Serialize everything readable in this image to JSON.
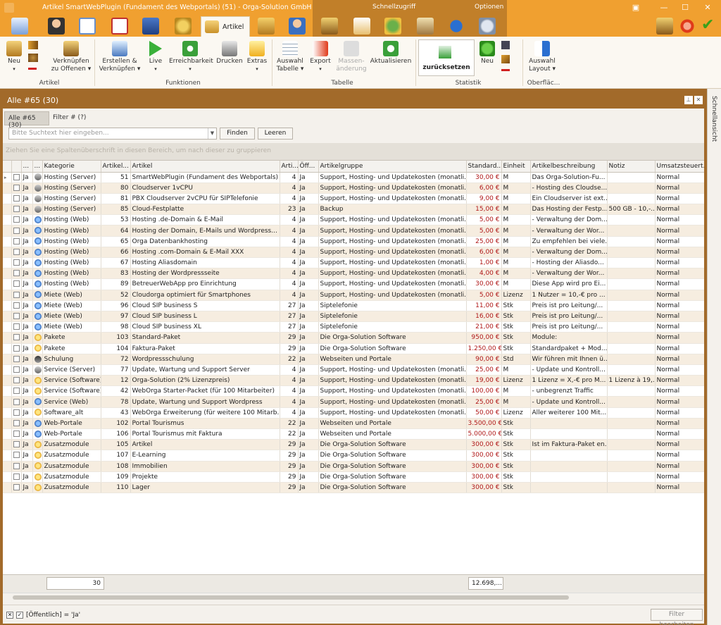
{
  "window": {
    "title": "Artikel SmartWebPlugin (Fundament des Webportals) (51) - Orga-Solution GmbH",
    "quick_access": "Schnellzugriff",
    "options": "Optionen"
  },
  "tabs": {
    "active": "Artikel"
  },
  "ribbon": {
    "neu": "Neu",
    "verknuepfen1": "Verknüpfen",
    "verknuepfen2": "zu Offenen",
    "group_artikel": "Artikel",
    "erstellen1": "Erstellen &",
    "erstellen2": "Verknüpfen",
    "live": "Live",
    "erreichbarkeit": "Erreichbarkeit",
    "drucken": "Drucken",
    "extras": "Extras",
    "group_funktionen": "Funktionen",
    "auswahl1": "Auswahl",
    "auswahl2": "Tabelle",
    "export": "Export",
    "massen1": "Massen-",
    "massen2": "änderung",
    "aktualisieren": "Aktualisieren",
    "group_tabelle": "Tabelle",
    "zuruecksetzen": "zurücksetzen",
    "neu2": "Neu",
    "group_statistik": "Statistik",
    "layout1": "Auswahl",
    "layout2": "Layout",
    "group_oberflaeche": "Oberfläc..."
  },
  "panel": {
    "title": "Alle #65 (30)",
    "filter_tab_active": "Alle #65 (30)",
    "filter_tab2": "Filter # (?)"
  },
  "search": {
    "placeholder": "Bitte Suchtext hier eingeben...",
    "find": "Finden",
    "clear": "Leeren"
  },
  "group_hint": "Ziehen Sie eine Spaltenüberschrift in diesen Bereich, um nach dieser zu gruppieren",
  "columns": [
    "...",
    "...",
    "Kategorie",
    "Artikel...",
    "Artikel",
    "Arti...",
    "Öff...",
    "Artikelgruppe",
    "Standard...",
    "Einheit",
    "Artikelbeschreibung",
    "Notiz",
    "Umsatzsteuert..."
  ],
  "rows": [
    {
      "oe": "Ja",
      "icon": "server",
      "kat": "Hosting (Server)",
      "nr": "51",
      "art": "SmartWebPlugin (Fundament des Webportals)",
      "a": "4",
      "pub": "Ja",
      "grp": "Support, Hosting- und Updatekosten (monatli...",
      "preis": "30,00 €",
      "einh": "M",
      "beschr": "Das Orga-Solution-Fu...",
      "notiz": "",
      "ust": "Normal"
    },
    {
      "oe": "Ja",
      "icon": "server",
      "kat": "Hosting (Server)",
      "nr": "80",
      "art": "Cloudserver 1vCPU",
      "a": "4",
      "pub": "Ja",
      "grp": "Support, Hosting- und Updatekosten (monatli...",
      "preis": "6,00 €",
      "einh": "M",
      "beschr": "- Hosting des Cloudse...",
      "notiz": "",
      "ust": "Normal"
    },
    {
      "oe": "Ja",
      "icon": "server",
      "kat": "Hosting (Server)",
      "nr": "81",
      "art": "PBX Cloudserver 2vCPU für SIPTelefonie",
      "a": "4",
      "pub": "Ja",
      "grp": "Support, Hosting- und Updatekosten (monatli...",
      "preis": "9,00 €",
      "einh": "M",
      "beschr": "Ein Cloudserver ist ext...",
      "notiz": "",
      "ust": "Normal"
    },
    {
      "oe": "Ja",
      "icon": "server",
      "kat": "Hosting (Server)",
      "nr": "85",
      "art": "Cloud-Festplatte",
      "a": "23",
      "pub": "Ja",
      "grp": "Backup",
      "preis": "15,00 €",
      "einh": "M",
      "beschr": "Das Hosting der Festp...",
      "notiz": "500 GB - 10,-...",
      "ust": "Normal"
    },
    {
      "oe": "Ja",
      "icon": "web",
      "kat": "Hosting (Web)",
      "nr": "53",
      "art": "Hosting .de-Domain & E-Mail",
      "a": "4",
      "pub": "Ja",
      "grp": "Support, Hosting- und Updatekosten (monatli...",
      "preis": "5,00 €",
      "einh": "M",
      "beschr": "- Verwaltung der Dom...",
      "notiz": "",
      "ust": "Normal"
    },
    {
      "oe": "Ja",
      "icon": "web",
      "kat": "Hosting (Web)",
      "nr": "64",
      "art": "Hosting der Domain, E-Mails und Wordpress...",
      "a": "4",
      "pub": "Ja",
      "grp": "Support, Hosting- und Updatekosten (monatli...",
      "preis": "5,00 €",
      "einh": "M",
      "beschr": "- Verwaltung der Wor...",
      "notiz": "",
      "ust": "Normal"
    },
    {
      "oe": "Ja",
      "icon": "web",
      "kat": "Hosting (Web)",
      "nr": "65",
      "art": "Orga Datenbankhosting",
      "a": "4",
      "pub": "Ja",
      "grp": "Support, Hosting- und Updatekosten (monatli...",
      "preis": "25,00 €",
      "einh": "M",
      "beschr": "Zu empfehlen bei viele...",
      "notiz": "",
      "ust": "Normal"
    },
    {
      "oe": "Ja",
      "icon": "web",
      "kat": "Hosting (Web)",
      "nr": "66",
      "art": "Hosting .com-Domain & E-Mail XXX",
      "a": "4",
      "pub": "Ja",
      "grp": "Support, Hosting- und Updatekosten (monatli...",
      "preis": "6,00 €",
      "einh": "M",
      "beschr": "- Verwaltung der Dom...",
      "notiz": "",
      "ust": "Normal"
    },
    {
      "oe": "Ja",
      "icon": "web",
      "kat": "Hosting (Web)",
      "nr": "67",
      "art": "Hosting Aliasdomain",
      "a": "4",
      "pub": "Ja",
      "grp": "Support, Hosting- und Updatekosten (monatli...",
      "preis": "1,00 €",
      "einh": "M",
      "beschr": "- Hosting der Aliasdo...",
      "notiz": "",
      "ust": "Normal"
    },
    {
      "oe": "Ja",
      "icon": "web",
      "kat": "Hosting (Web)",
      "nr": "83",
      "art": "Hosting der Wordpressseite",
      "a": "4",
      "pub": "Ja",
      "grp": "Support, Hosting- und Updatekosten (monatli...",
      "preis": "4,00 €",
      "einh": "M",
      "beschr": "- Verwaltung der Wor...",
      "notiz": "",
      "ust": "Normal"
    },
    {
      "oe": "Ja",
      "icon": "web",
      "kat": "Hosting (Web)",
      "nr": "89",
      "art": "BetreuerWebApp pro Einrichtung",
      "a": "4",
      "pub": "Ja",
      "grp": "Support, Hosting- und Updatekosten (monatli...",
      "preis": "30,00 €",
      "einh": "M",
      "beschr": "Diese App wird pro Ei...",
      "notiz": "",
      "ust": "Normal"
    },
    {
      "oe": "Ja",
      "icon": "web",
      "kat": "Miete (Web)",
      "nr": "52",
      "art": "Cloudorga optimiert für Smartphones",
      "a": "4",
      "pub": "Ja",
      "grp": "Support, Hosting- und Updatekosten (monatli...",
      "preis": "5,00 €",
      "einh": "Lizenz",
      "beschr": "1 Nutzer = 10,-€ pro ...",
      "notiz": "",
      "ust": "Normal"
    },
    {
      "oe": "Ja",
      "icon": "web",
      "kat": "Miete (Web)",
      "nr": "96",
      "art": "Cloud SIP business S",
      "a": "27",
      "pub": "Ja",
      "grp": "Siptelefonie",
      "preis": "11,00 €",
      "einh": "Stk",
      "beschr": "Preis ist pro Leitung/...",
      "notiz": "",
      "ust": "Normal"
    },
    {
      "oe": "Ja",
      "icon": "web",
      "kat": "Miete (Web)",
      "nr": "97",
      "art": "Cloud SIP business L",
      "a": "27",
      "pub": "Ja",
      "grp": "Siptelefonie",
      "preis": "16,00 €",
      "einh": "Stk",
      "beschr": "Preis ist pro Leitung/...",
      "notiz": "",
      "ust": "Normal"
    },
    {
      "oe": "Ja",
      "icon": "web",
      "kat": "Miete (Web)",
      "nr": "98",
      "art": "Cloud SIP business XL",
      "a": "27",
      "pub": "Ja",
      "grp": "Siptelefonie",
      "preis": "21,00 €",
      "einh": "Stk",
      "beschr": "Preis ist pro Leitung/...",
      "notiz": "",
      "ust": "Normal"
    },
    {
      "oe": "Ja",
      "icon": "star",
      "kat": "Pakete",
      "nr": "103",
      "art": "Standard-Paket",
      "a": "29",
      "pub": "Ja",
      "grp": "Die Orga-Solution Software",
      "preis": "950,00 €",
      "einh": "Stk",
      "beschr": "Module:",
      "notiz": "",
      "ust": "Normal"
    },
    {
      "oe": "Ja",
      "icon": "star",
      "kat": "Pakete",
      "nr": "104",
      "art": "Faktura-Paket",
      "a": "29",
      "pub": "Ja",
      "grp": "Die Orga-Solution Software",
      "preis": "1.250,00 €",
      "einh": "Stk",
      "beschr": "Standardpaket + Mod...",
      "notiz": "",
      "ust": "Normal"
    },
    {
      "oe": "Ja",
      "icon": "school",
      "kat": "Schulung",
      "nr": "72",
      "art": "Wordpressschulung",
      "a": "22",
      "pub": "Ja",
      "grp": "Webseiten und Portale",
      "preis": "90,00 €",
      "einh": "Std",
      "beschr": "Wir führen mit Ihnen ü...",
      "notiz": "",
      "ust": "Normal"
    },
    {
      "oe": "Ja",
      "icon": "server",
      "kat": "Service (Server)",
      "nr": "77",
      "art": "Update, Wartung und Support Server",
      "a": "4",
      "pub": "Ja",
      "grp": "Support, Hosting- und Updatekosten (monatli...",
      "preis": "25,00 €",
      "einh": "M",
      "beschr": "- Update und Kontroll...",
      "notiz": "",
      "ust": "Normal"
    },
    {
      "oe": "Ja",
      "icon": "star",
      "kat": "Service (Software)",
      "nr": "12",
      "art": "Orga-Solution (2% Lizenzpreis)",
      "a": "4",
      "pub": "Ja",
      "grp": "Support, Hosting- und Updatekosten (monatli...",
      "preis": "19,00 €",
      "einh": "Lizenz",
      "beschr": "1 Lizenz = X,-€ pro M...",
      "notiz": "1 Lizenz à 19,...",
      "ust": "Normal"
    },
    {
      "oe": "Ja",
      "icon": "star",
      "kat": "Service (Software)",
      "nr": "42",
      "art": "WebOrga Starter-Packet (für 100 Mitarbeiter)",
      "a": "4",
      "pub": "Ja",
      "grp": "Support, Hosting- und Updatekosten (monatli...",
      "preis": "100,00 €",
      "einh": "M",
      "beschr": "- unbegrenzt Traffic",
      "notiz": "",
      "ust": "Normal"
    },
    {
      "oe": "Ja",
      "icon": "web",
      "kat": "Service (Web)",
      "nr": "78",
      "art": "Update, Wartung und Support Wordpress",
      "a": "4",
      "pub": "Ja",
      "grp": "Support, Hosting- und Updatekosten (monatli...",
      "preis": "25,00 €",
      "einh": "M",
      "beschr": "- Update und Kontroll...",
      "notiz": "",
      "ust": "Normal"
    },
    {
      "oe": "Ja",
      "icon": "star",
      "kat": "Software_alt",
      "nr": "43",
      "art": "WebOrga Erweiterung (für weitere 100 Mitarb...",
      "a": "4",
      "pub": "Ja",
      "grp": "Support, Hosting- und Updatekosten (monatli...",
      "preis": "50,00 €",
      "einh": "Lizenz",
      "beschr": "Aller weiterer 100 Mit...",
      "notiz": "",
      "ust": "Normal"
    },
    {
      "oe": "Ja",
      "icon": "web",
      "kat": "Web-Portale",
      "nr": "102",
      "art": "Portal Tourismus",
      "a": "22",
      "pub": "Ja",
      "grp": "Webseiten und Portale",
      "preis": "3.500,00 €",
      "einh": "Stk",
      "beschr": "",
      "notiz": "",
      "ust": "Normal"
    },
    {
      "oe": "Ja",
      "icon": "web",
      "kat": "Web-Portale",
      "nr": "106",
      "art": "Portal Tourismus mit Faktura",
      "a": "22",
      "pub": "Ja",
      "grp": "Webseiten und Portale",
      "preis": "5.000,00 €",
      "einh": "Stk",
      "beschr": "",
      "notiz": "",
      "ust": "Normal"
    },
    {
      "oe": "Ja",
      "icon": "star",
      "kat": "Zusatzmodule",
      "nr": "105",
      "art": "Artikel",
      "a": "29",
      "pub": "Ja",
      "grp": "Die Orga-Solution Software",
      "preis": "300,00 €",
      "einh": "Stk",
      "beschr": "Ist im Faktura-Paket en...",
      "notiz": "",
      "ust": "Normal"
    },
    {
      "oe": "Ja",
      "icon": "star",
      "kat": "Zusatzmodule",
      "nr": "107",
      "art": "E-Learning",
      "a": "29",
      "pub": "Ja",
      "grp": "Die Orga-Solution Software",
      "preis": "300,00 €",
      "einh": "Stk",
      "beschr": "",
      "notiz": "",
      "ust": "Normal"
    },
    {
      "oe": "Ja",
      "icon": "star",
      "kat": "Zusatzmodule",
      "nr": "108",
      "art": "Immobilien",
      "a": "29",
      "pub": "Ja",
      "grp": "Die Orga-Solution Software",
      "preis": "300,00 €",
      "einh": "Stk",
      "beschr": "",
      "notiz": "",
      "ust": "Normal"
    },
    {
      "oe": "Ja",
      "icon": "star",
      "kat": "Zusatzmodule",
      "nr": "109",
      "art": "Projekte",
      "a": "29",
      "pub": "Ja",
      "grp": "Die Orga-Solution Software",
      "preis": "300,00 €",
      "einh": "Stk",
      "beschr": "",
      "notiz": "",
      "ust": "Normal"
    },
    {
      "oe": "Ja",
      "icon": "star",
      "kat": "Zusatzmodule",
      "nr": "110",
      "art": "Lager",
      "a": "29",
      "pub": "Ja",
      "grp": "Die Orga-Solution Software",
      "preis": "300,00 €",
      "einh": "Stk",
      "beschr": "",
      "notiz": "",
      "ust": "Normal"
    }
  ],
  "footer": {
    "count": "30",
    "sum": "12.698,..."
  },
  "status": {
    "filter_text": "[Öffentlich] = 'Ja'",
    "edit_filter": "Filter bearbeiten"
  },
  "sidebar": {
    "label": "Schnellansicht"
  },
  "colors": {
    "accent": "#f0a030",
    "panel": "#a26a2a",
    "price": "#b01818"
  }
}
